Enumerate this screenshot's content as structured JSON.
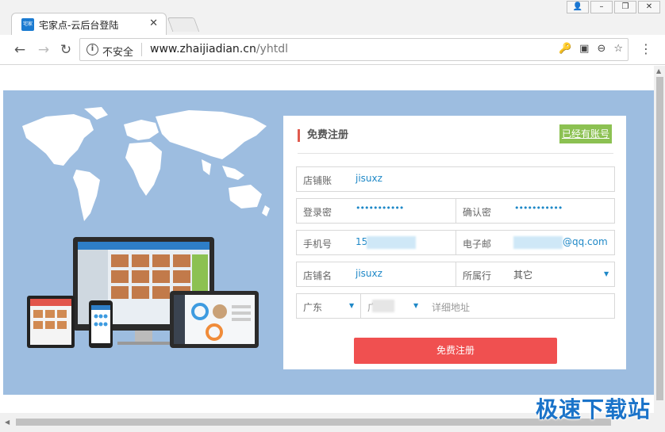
{
  "browser": {
    "tab_title": "宅家点-云后台登陆",
    "tab_favicon_text": "宅家点",
    "security_label": "不安全",
    "url_host": "www.zhaijiadian.cn",
    "url_path": "/yhtdl"
  },
  "form": {
    "title": "免费注册",
    "have_account": "已经有账号",
    "store_account_label": "店铺账",
    "store_account_value": "jisuxz",
    "password_label": "登录密",
    "password_value": "•••••••••••",
    "confirm_label": "确认密",
    "confirm_value": "•••••••••••",
    "phone_label": "手机号",
    "phone_value": "15",
    "email_label": "电子邮",
    "email_value": "@qq.com",
    "store_name_label": "店铺名",
    "store_name_value": "jisuxz",
    "industry_label": "所属行",
    "industry_value": "其它",
    "province_value": "广东",
    "city_value": "广",
    "address_placeholder": "详细地址",
    "submit_label": "免费注册"
  },
  "watermark": "极速下载站",
  "colors": {
    "hero_bg": "#9dbde0",
    "accent_red": "#f05050",
    "accent_green": "#8cc152",
    "value_blue": "#1e88c7"
  }
}
